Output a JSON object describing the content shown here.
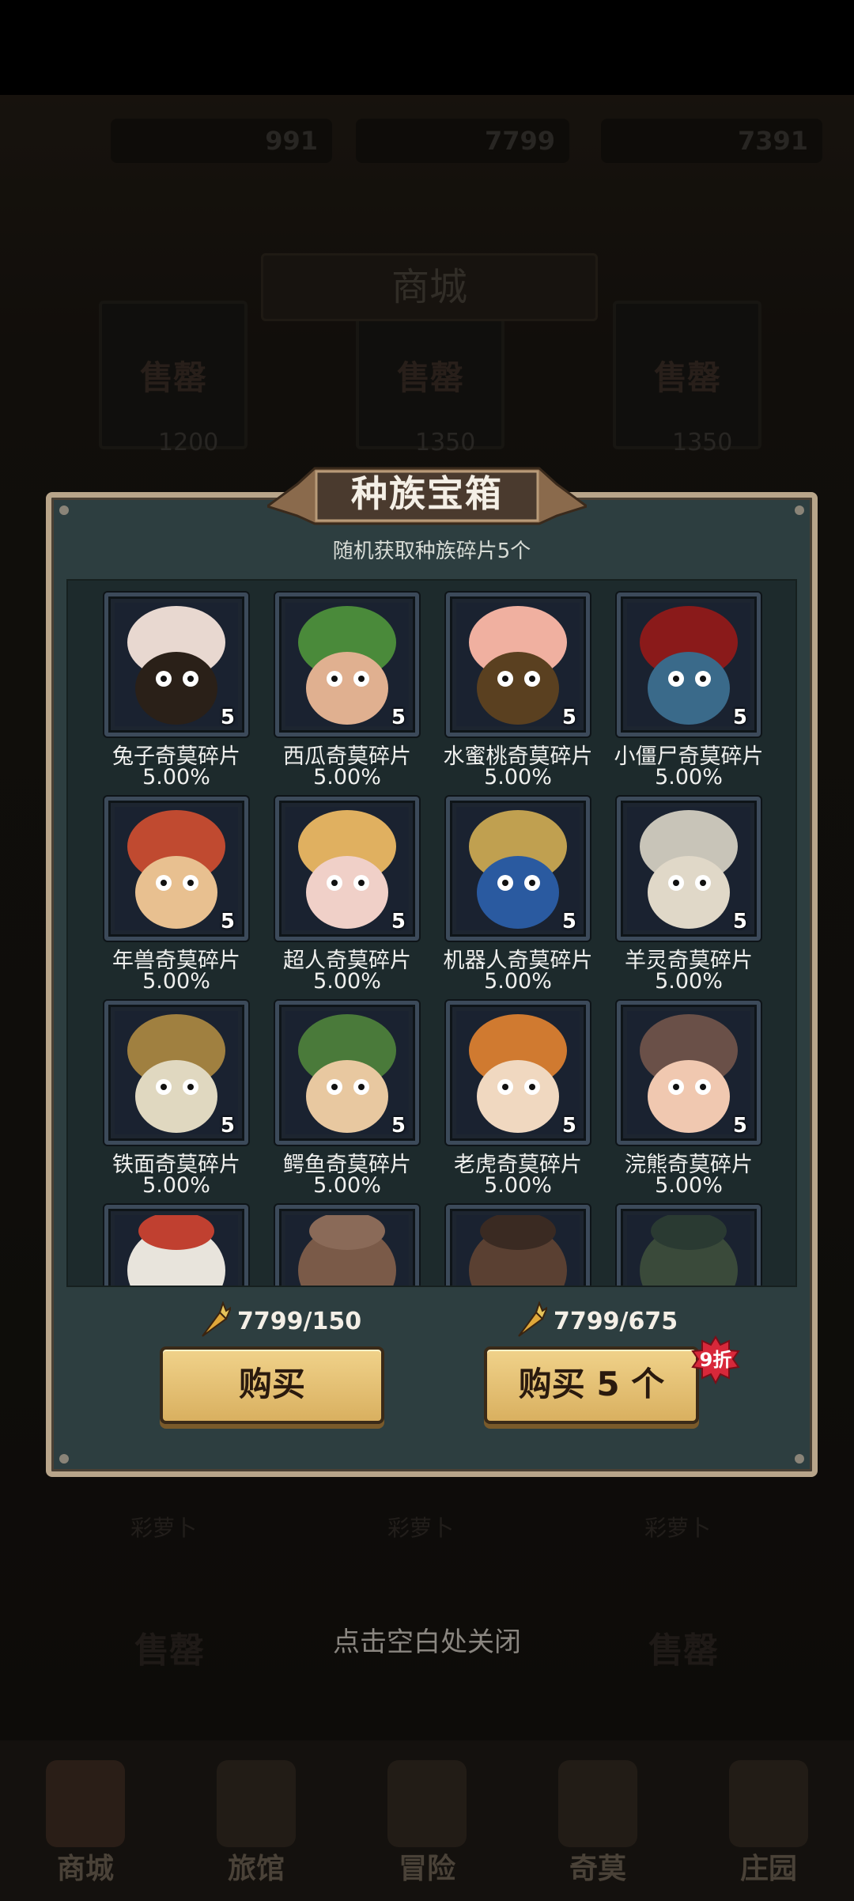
{
  "background": {
    "currencies": [
      "991",
      "7799",
      "7391"
    ],
    "shop_title": "商城",
    "sold_label": "售罄",
    "prices": [
      "1200",
      "1350",
      "1350"
    ],
    "item_labels": [
      "彩萝卜",
      "彩萝卜",
      "彩萝卜"
    ],
    "close_hint": "点击空白处关闭"
  },
  "dialog": {
    "title": "种族宝箱",
    "subtitle": "随机获取种族碎片5个",
    "items": [
      {
        "name": "兔子奇莫碎片",
        "pct": "5.00%",
        "count": "5",
        "icon": "rabbit-portrait-icon"
      },
      {
        "name": "西瓜奇莫碎片",
        "pct": "5.00%",
        "count": "5",
        "icon": "watermelon-portrait-icon"
      },
      {
        "name": "水蜜桃奇莫碎片",
        "pct": "5.00%",
        "count": "5",
        "icon": "peach-portrait-icon"
      },
      {
        "name": "小僵尸奇莫碎片",
        "pct": "5.00%",
        "count": "5",
        "icon": "zombie-portrait-icon"
      },
      {
        "name": "年兽奇莫碎片",
        "pct": "5.00%",
        "count": "5",
        "icon": "nian-beast-portrait-icon"
      },
      {
        "name": "超人奇莫碎片",
        "pct": "5.00%",
        "count": "5",
        "icon": "superman-portrait-icon"
      },
      {
        "name": "机器人奇莫碎片",
        "pct": "5.00%",
        "count": "5",
        "icon": "robot-portrait-icon"
      },
      {
        "name": "羊灵奇莫碎片",
        "pct": "5.00%",
        "count": "5",
        "icon": "goat-spirit-portrait-icon"
      },
      {
        "name": "铁面奇莫碎片",
        "pct": "5.00%",
        "count": "5",
        "icon": "iron-mask-portrait-icon"
      },
      {
        "name": "鳄鱼奇莫碎片",
        "pct": "5.00%",
        "count": "5",
        "icon": "crocodile-portrait-icon"
      },
      {
        "name": "老虎奇莫碎片",
        "pct": "5.00%",
        "count": "5",
        "icon": "tiger-portrait-icon"
      },
      {
        "name": "浣熊奇莫碎片",
        "pct": "5.00%",
        "count": "5",
        "icon": "raccoon-portrait-icon"
      }
    ],
    "partial_items": [
      "chicken-portrait-icon",
      "hippo-portrait-icon",
      "cowboy-portrait-icon",
      "frog-portrait-icon"
    ],
    "buy_one": {
      "cost": "7799/150",
      "label": "购买"
    },
    "buy_five": {
      "cost": "7799/675",
      "label": "购买 5 个",
      "discount": "9折"
    }
  },
  "nav": [
    {
      "label": "商城",
      "icon": "shop-icon"
    },
    {
      "label": "旅馆",
      "icon": "inn-icon"
    },
    {
      "label": "冒险",
      "icon": "crossed-swords-icon"
    },
    {
      "label": "奇莫",
      "icon": "character-icon"
    },
    {
      "label": "庄园",
      "icon": "manor-icon"
    }
  ],
  "colors": {
    "dialog_bg": "#2d3e40",
    "dialog_border": "#b8a58a",
    "button": "#e6c274",
    "badge": "#d8283a"
  }
}
